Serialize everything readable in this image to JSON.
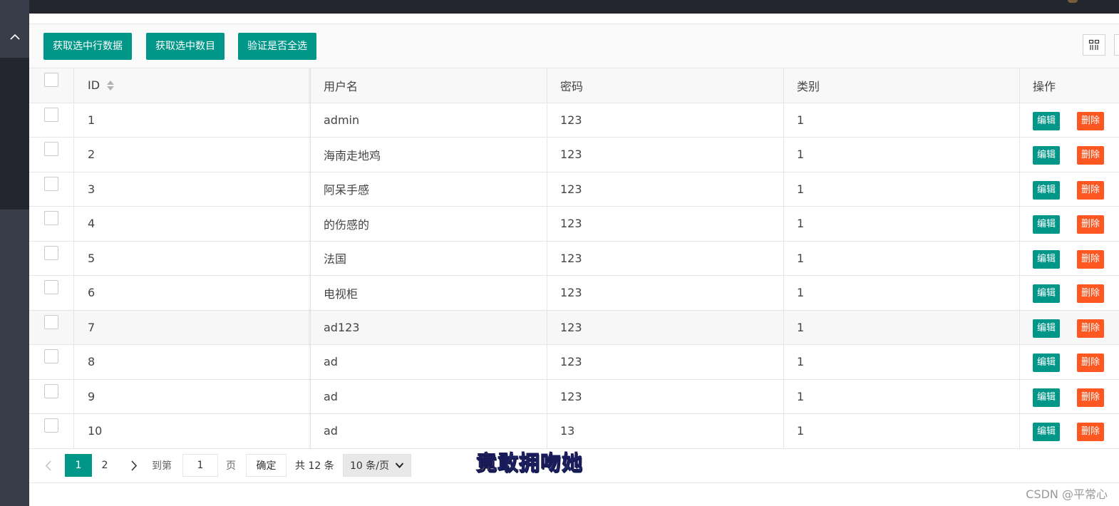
{
  "toolbar": {
    "buttons": [
      "获取选中行数据",
      "获取选中数目",
      "验证是否全选"
    ],
    "icons": [
      "column-filter-icon",
      "export-icon"
    ]
  },
  "table": {
    "columns": [
      "ID",
      "用户名",
      "密码",
      "类别",
      "操作"
    ],
    "rows": [
      {
        "id": "1",
        "username": "admin",
        "password": "123",
        "category": "1"
      },
      {
        "id": "2",
        "username": "海南走地鸡",
        "password": "123",
        "category": "1"
      },
      {
        "id": "3",
        "username": "阿呆手感",
        "password": "123",
        "category": "1"
      },
      {
        "id": "4",
        "username": "的伤感的",
        "password": "123",
        "category": "1"
      },
      {
        "id": "5",
        "username": "法国",
        "password": "123",
        "category": "1"
      },
      {
        "id": "6",
        "username": "电视柜",
        "password": "123",
        "category": "1"
      },
      {
        "id": "7",
        "username": "ad123",
        "password": "123",
        "category": "1"
      },
      {
        "id": "8",
        "username": "ad",
        "password": "123",
        "category": "1"
      },
      {
        "id": "9",
        "username": "ad",
        "password": "123",
        "category": "1"
      },
      {
        "id": "10",
        "username": "ad",
        "password": "13",
        "category": "1"
      }
    ],
    "edit_label": "编辑",
    "delete_label": "删除",
    "hovered_row": 7
  },
  "pagination": {
    "pages": [
      "1",
      "2"
    ],
    "current_page": "1",
    "goto_prefix": "到第",
    "goto_value": "1",
    "goto_suffix": "页",
    "confirm_label": "确定",
    "total_text": "共 12 条",
    "page_size_selected": "10 条/页"
  },
  "overlay": {
    "first_char": "竟",
    "rest": "敢拥吻她"
  },
  "watermark": "CSDN @平常心",
  "colors": {
    "primary": "#009688",
    "danger": "#ff5722",
    "sidebar": "#393d49",
    "topbar": "#23262e"
  }
}
